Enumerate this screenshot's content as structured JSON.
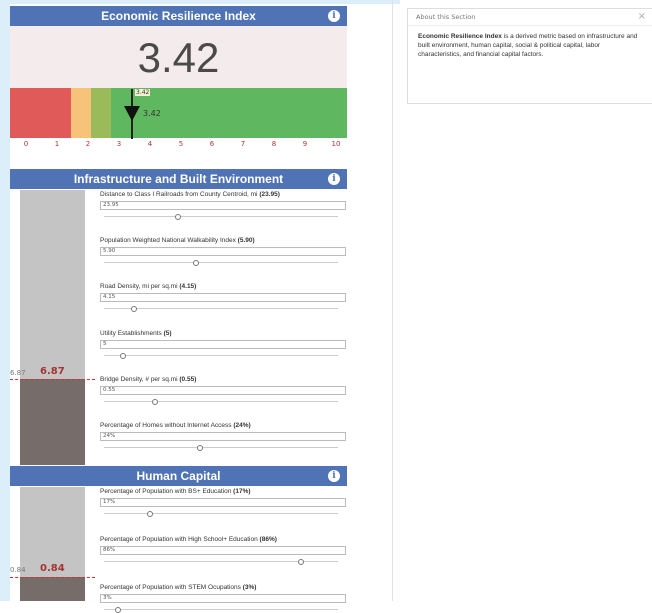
{
  "colors": {
    "header": "#4f73b5",
    "red": "#e05a5a",
    "orange": "#f7c27a",
    "light_green": "#9bba5a",
    "green": "#5fb85f",
    "bar_fill": "#766c69",
    "bar_bg": "#c4c4c4"
  },
  "index": {
    "title": "Economic Resilience Index",
    "score": "3.42",
    "marker_tag": "3.42",
    "marker_text": "3.42",
    "marker_value": 3.42,
    "scale": {
      "min": 0,
      "max": 10,
      "bands": [
        {
          "from": 0,
          "to": 1.8,
          "color": "red"
        },
        {
          "from": 1.8,
          "to": 2.4,
          "color": "orange"
        },
        {
          "from": 2.4,
          "to": 3.0,
          "color": "light_green"
        },
        {
          "from": 3.0,
          "to": 10,
          "color": "green"
        }
      ]
    },
    "ticks": [
      "0",
      "1",
      "2",
      "3",
      "4",
      "5",
      "6",
      "7",
      "8",
      "9",
      "10"
    ]
  },
  "infrastructure": {
    "title": "Infrastructure and Built Environment",
    "bar_value": 0.687,
    "bar_label": "6.87",
    "bar_label_small": "6.87",
    "metrics": [
      {
        "label": "Distance to Class I Railroads from County Centroid, mi",
        "bold": "(23.95)",
        "input": "23.95",
        "slider": 0.31
      },
      {
        "label": "Population Weighted National Walkability Index",
        "bold": "(5.90)",
        "input": "5.90",
        "slider": 0.39
      },
      {
        "label": "Road Density, mi per sq.mi",
        "bold": "(4.15)",
        "input": "4.15",
        "slider": 0.12
      },
      {
        "label": "Utility Establishments",
        "bold": "(5)",
        "input": "5",
        "slider": 0.07
      },
      {
        "label": "Bridge Density, # per sq.mi",
        "bold": "(0.55)",
        "input": "0.55",
        "slider": 0.21
      },
      {
        "label": "Percentage of Homes without Internet Access",
        "bold": "(24%)",
        "input": "24%",
        "slider": 0.41
      }
    ]
  },
  "human_capital": {
    "title": "Human Capital",
    "bar_value": 0.084,
    "bar_label": "0.84",
    "bar_label_small": "0.84",
    "metrics": [
      {
        "label": "Percentage of Population with BS+ Education",
        "bold": "(17%)",
        "input": "17%",
        "slider": 0.19
      },
      {
        "label": "Percentage of Population with High School+ Education",
        "bold": "(86%)",
        "input": "86%",
        "slider": 0.85
      },
      {
        "label": "Percentage of Population with STEM Ocupations",
        "bold": "(3%)",
        "input": "3%",
        "slider": 0.05
      }
    ]
  },
  "about": {
    "header": "About this Section",
    "close": "×",
    "bold": "Economic Resilience Index",
    "text": " is a derived metric based on infrastructure and built environment, human capital, social & political capital, labor characteristics, and financial capital factors."
  }
}
